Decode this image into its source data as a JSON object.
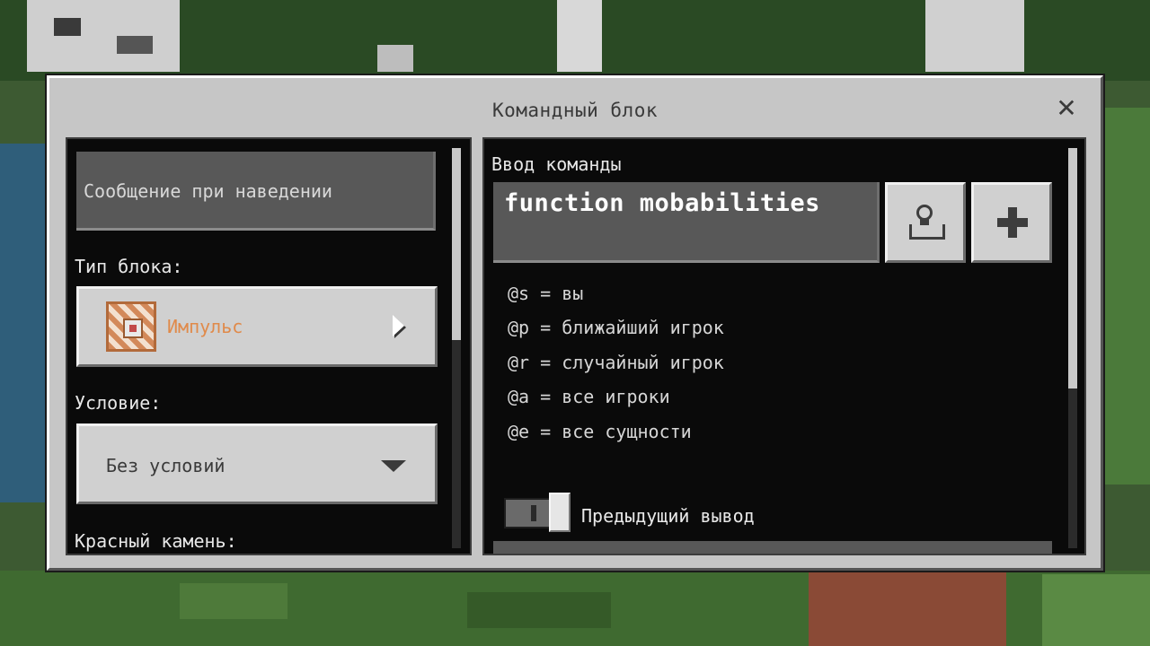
{
  "dialog": {
    "title": "Командный блок",
    "close_icon": "close-icon"
  },
  "left": {
    "hover_message_placeholder": "Сообщение при наведении",
    "block_type_label": "Тип блока:",
    "block_type_value": "Импульс",
    "block_type_icon": "command-block-icon",
    "condition_label": "Условие:",
    "condition_value": "Без условий",
    "redstone_label": "Красный камень:"
  },
  "right": {
    "command_input_label": "Ввод команды",
    "command_value": "function mobabilities",
    "paste_icon": "paste-icon",
    "add_icon": "plus-icon",
    "selectors": [
      "@s = вы",
      "@p = ближайший игрок",
      "@r = случайный игрок",
      "@a = все игроки",
      "@e = все сущности"
    ],
    "previous_output_label": "Предыдущий вывод"
  },
  "colors": {
    "dialog_bg": "#c6c6c6",
    "panel_bg": "#0a0a0a",
    "accent_orange": "#e08a4a"
  }
}
